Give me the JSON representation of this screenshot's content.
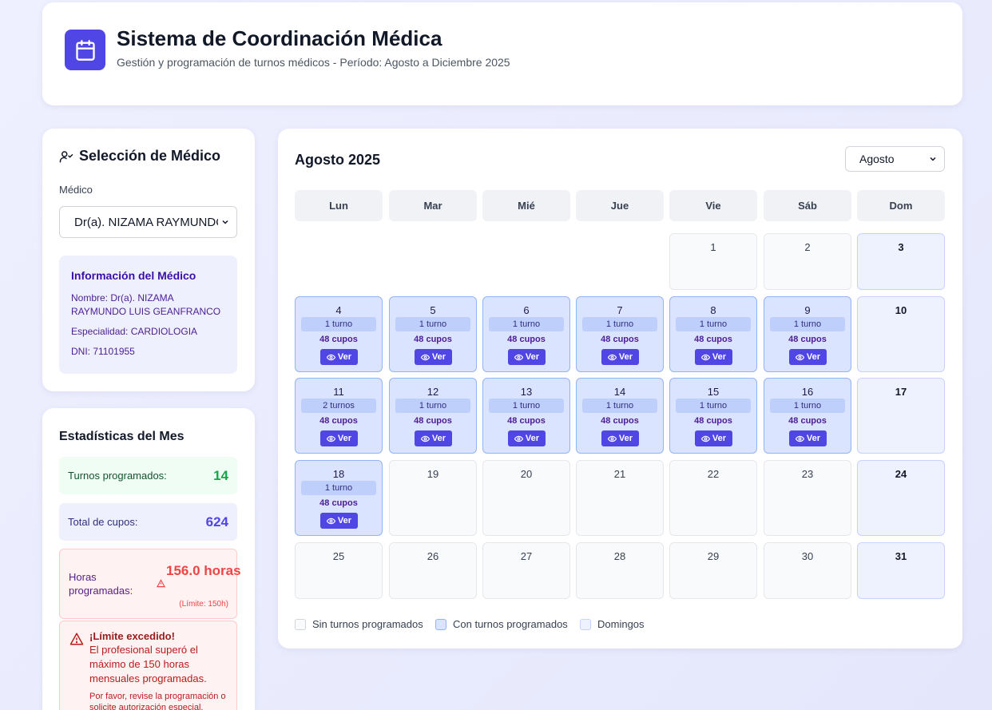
{
  "header": {
    "title": "Sistema de Coordinación Médica",
    "subtitle": "Gestión y programación de turnos médicos - Período: Agosto a Diciembre 2025"
  },
  "doctor_selection": {
    "title": "Selección de Médico",
    "field_label": "Médico",
    "selected_value": "Dr(a). NIZAMA RAYMUNDO LUIS GEANFRANCO",
    "info": {
      "heading": "Información del Médico",
      "name": "Nombre: Dr(a). NIZAMA RAYMUNDO LUIS GEANFRANCO",
      "specialty": "Especialidad: CARDIOLOGIA",
      "dni": "DNI: 71101955"
    }
  },
  "stats": {
    "title": "Estadísticas del Mes",
    "shifts_label": "Turnos programados:",
    "shifts_value": "14",
    "slots_label": "Total de cupos:",
    "slots_value": "624",
    "hours_label": "Horas programadas:",
    "hours_value": "156.0 horas",
    "hours_limit": "(Límite: 150h)",
    "alert": {
      "title": "¡Límite excedido!",
      "body": "El profesional superó el máximo de 150 horas mensuales programadas.",
      "note": "Por favor, revise la programación o solicite autorización especial."
    }
  },
  "calendar": {
    "title": "Agosto 2025",
    "month_select": "Agosto",
    "weekdays": [
      "Lun",
      "Mar",
      "Mié",
      "Jue",
      "Vie",
      "Sáb",
      "Dom"
    ],
    "view_label": "Ver",
    "days": [
      {
        "n": "1",
        "kind": "empty"
      },
      {
        "n": "2",
        "kind": "empty"
      },
      {
        "n": "3",
        "kind": "sun"
      },
      {
        "n": "4",
        "kind": "has",
        "turns": "1 turno",
        "slots": "48 cupos"
      },
      {
        "n": "5",
        "kind": "has",
        "turns": "1 turno",
        "slots": "48 cupos"
      },
      {
        "n": "6",
        "kind": "has",
        "turns": "1 turno",
        "slots": "48 cupos"
      },
      {
        "n": "7",
        "kind": "has",
        "turns": "1 turno",
        "slots": "48 cupos"
      },
      {
        "n": "8",
        "kind": "has",
        "turns": "1 turno",
        "slots": "48 cupos"
      },
      {
        "n": "9",
        "kind": "has",
        "turns": "1 turno",
        "slots": "48 cupos"
      },
      {
        "n": "10",
        "kind": "sun"
      },
      {
        "n": "11",
        "kind": "has",
        "turns": "2 turnos",
        "slots": "48 cupos"
      },
      {
        "n": "12",
        "kind": "has",
        "turns": "1 turno",
        "slots": "48 cupos"
      },
      {
        "n": "13",
        "kind": "has",
        "turns": "1 turno",
        "slots": "48 cupos"
      },
      {
        "n": "14",
        "kind": "has",
        "turns": "1 turno",
        "slots": "48 cupos"
      },
      {
        "n": "15",
        "kind": "has",
        "turns": "1 turno",
        "slots": "48 cupos"
      },
      {
        "n": "16",
        "kind": "has",
        "turns": "1 turno",
        "slots": "48 cupos"
      },
      {
        "n": "17",
        "kind": "sun"
      },
      {
        "n": "18",
        "kind": "has",
        "turns": "1 turno",
        "slots": "48 cupos"
      },
      {
        "n": "19",
        "kind": "empty"
      },
      {
        "n": "20",
        "kind": "empty"
      },
      {
        "n": "21",
        "kind": "empty"
      },
      {
        "n": "22",
        "kind": "empty"
      },
      {
        "n": "23",
        "kind": "empty"
      },
      {
        "n": "24",
        "kind": "sun"
      },
      {
        "n": "25",
        "kind": "empty"
      },
      {
        "n": "26",
        "kind": "empty"
      },
      {
        "n": "27",
        "kind": "empty"
      },
      {
        "n": "28",
        "kind": "empty"
      },
      {
        "n": "29",
        "kind": "empty"
      },
      {
        "n": "30",
        "kind": "empty"
      },
      {
        "n": "31",
        "kind": "sun"
      }
    ],
    "legend": {
      "none": "Sin turnos programados",
      "with": "Con turnos programados",
      "sundays": "Domingos"
    }
  },
  "colors": {
    "accent": "#4f46e5",
    "scheduled_day": "#dbe4fe",
    "sunday": "#eef2ff",
    "danger": "#ef4444",
    "success": "#16a34a"
  }
}
